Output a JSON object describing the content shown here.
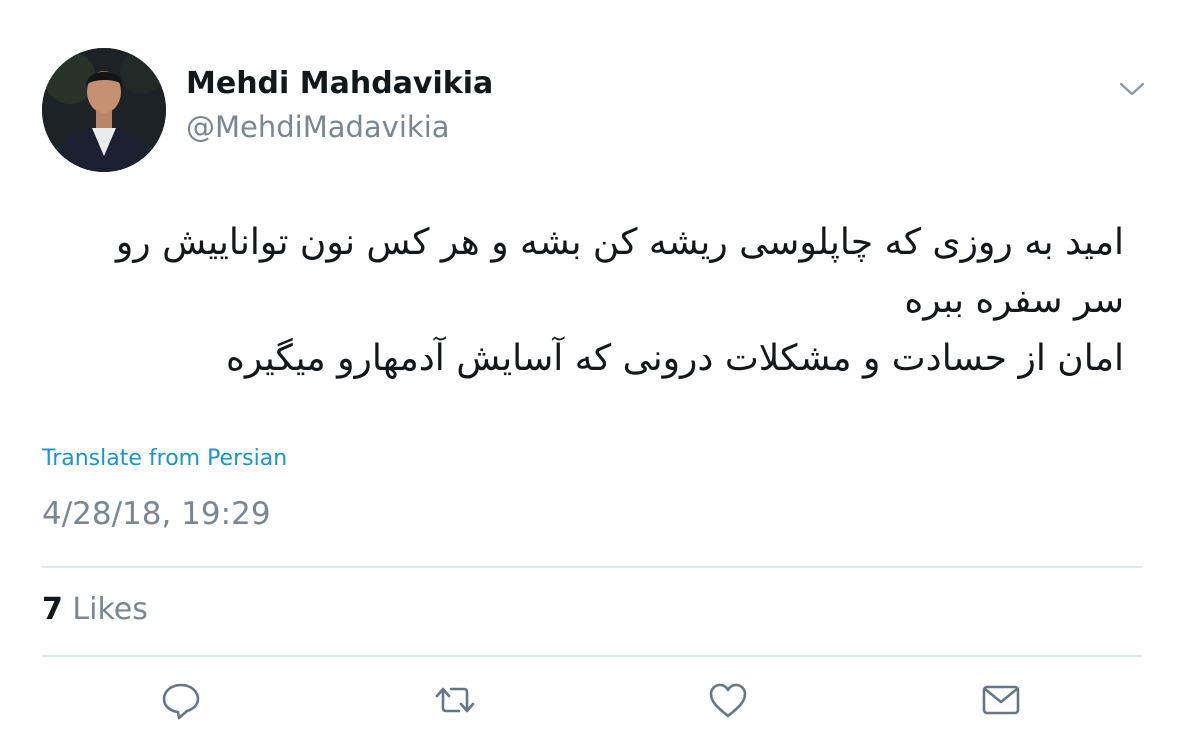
{
  "author": {
    "display_name": "Mehdi Mahdavikia",
    "handle": "@MehdiMadavikia"
  },
  "tweet": {
    "lines": [
      "امید به روزی که چاپلوسی ریشه کن بشه و هر کس نون تواناییش رو",
      "سر سفره ببره",
      "امان از حسادت و مشکلات درونی که آسایش آدمهارو میگیره"
    ],
    "translate_label": "Translate from Persian",
    "timestamp": "4/28/18, 19:29"
  },
  "stats": {
    "likes_count": "7",
    "likes_label": "Likes"
  },
  "icons": {
    "caret": "chevron-down-icon",
    "reply": "reply-icon",
    "retweet": "retweet-icon",
    "like": "heart-icon",
    "message": "envelope-icon"
  },
  "colors": {
    "text": "#14171a",
    "secondary": "#7a8793",
    "link": "#1b95c8",
    "divider": "#e1e8ed"
  }
}
